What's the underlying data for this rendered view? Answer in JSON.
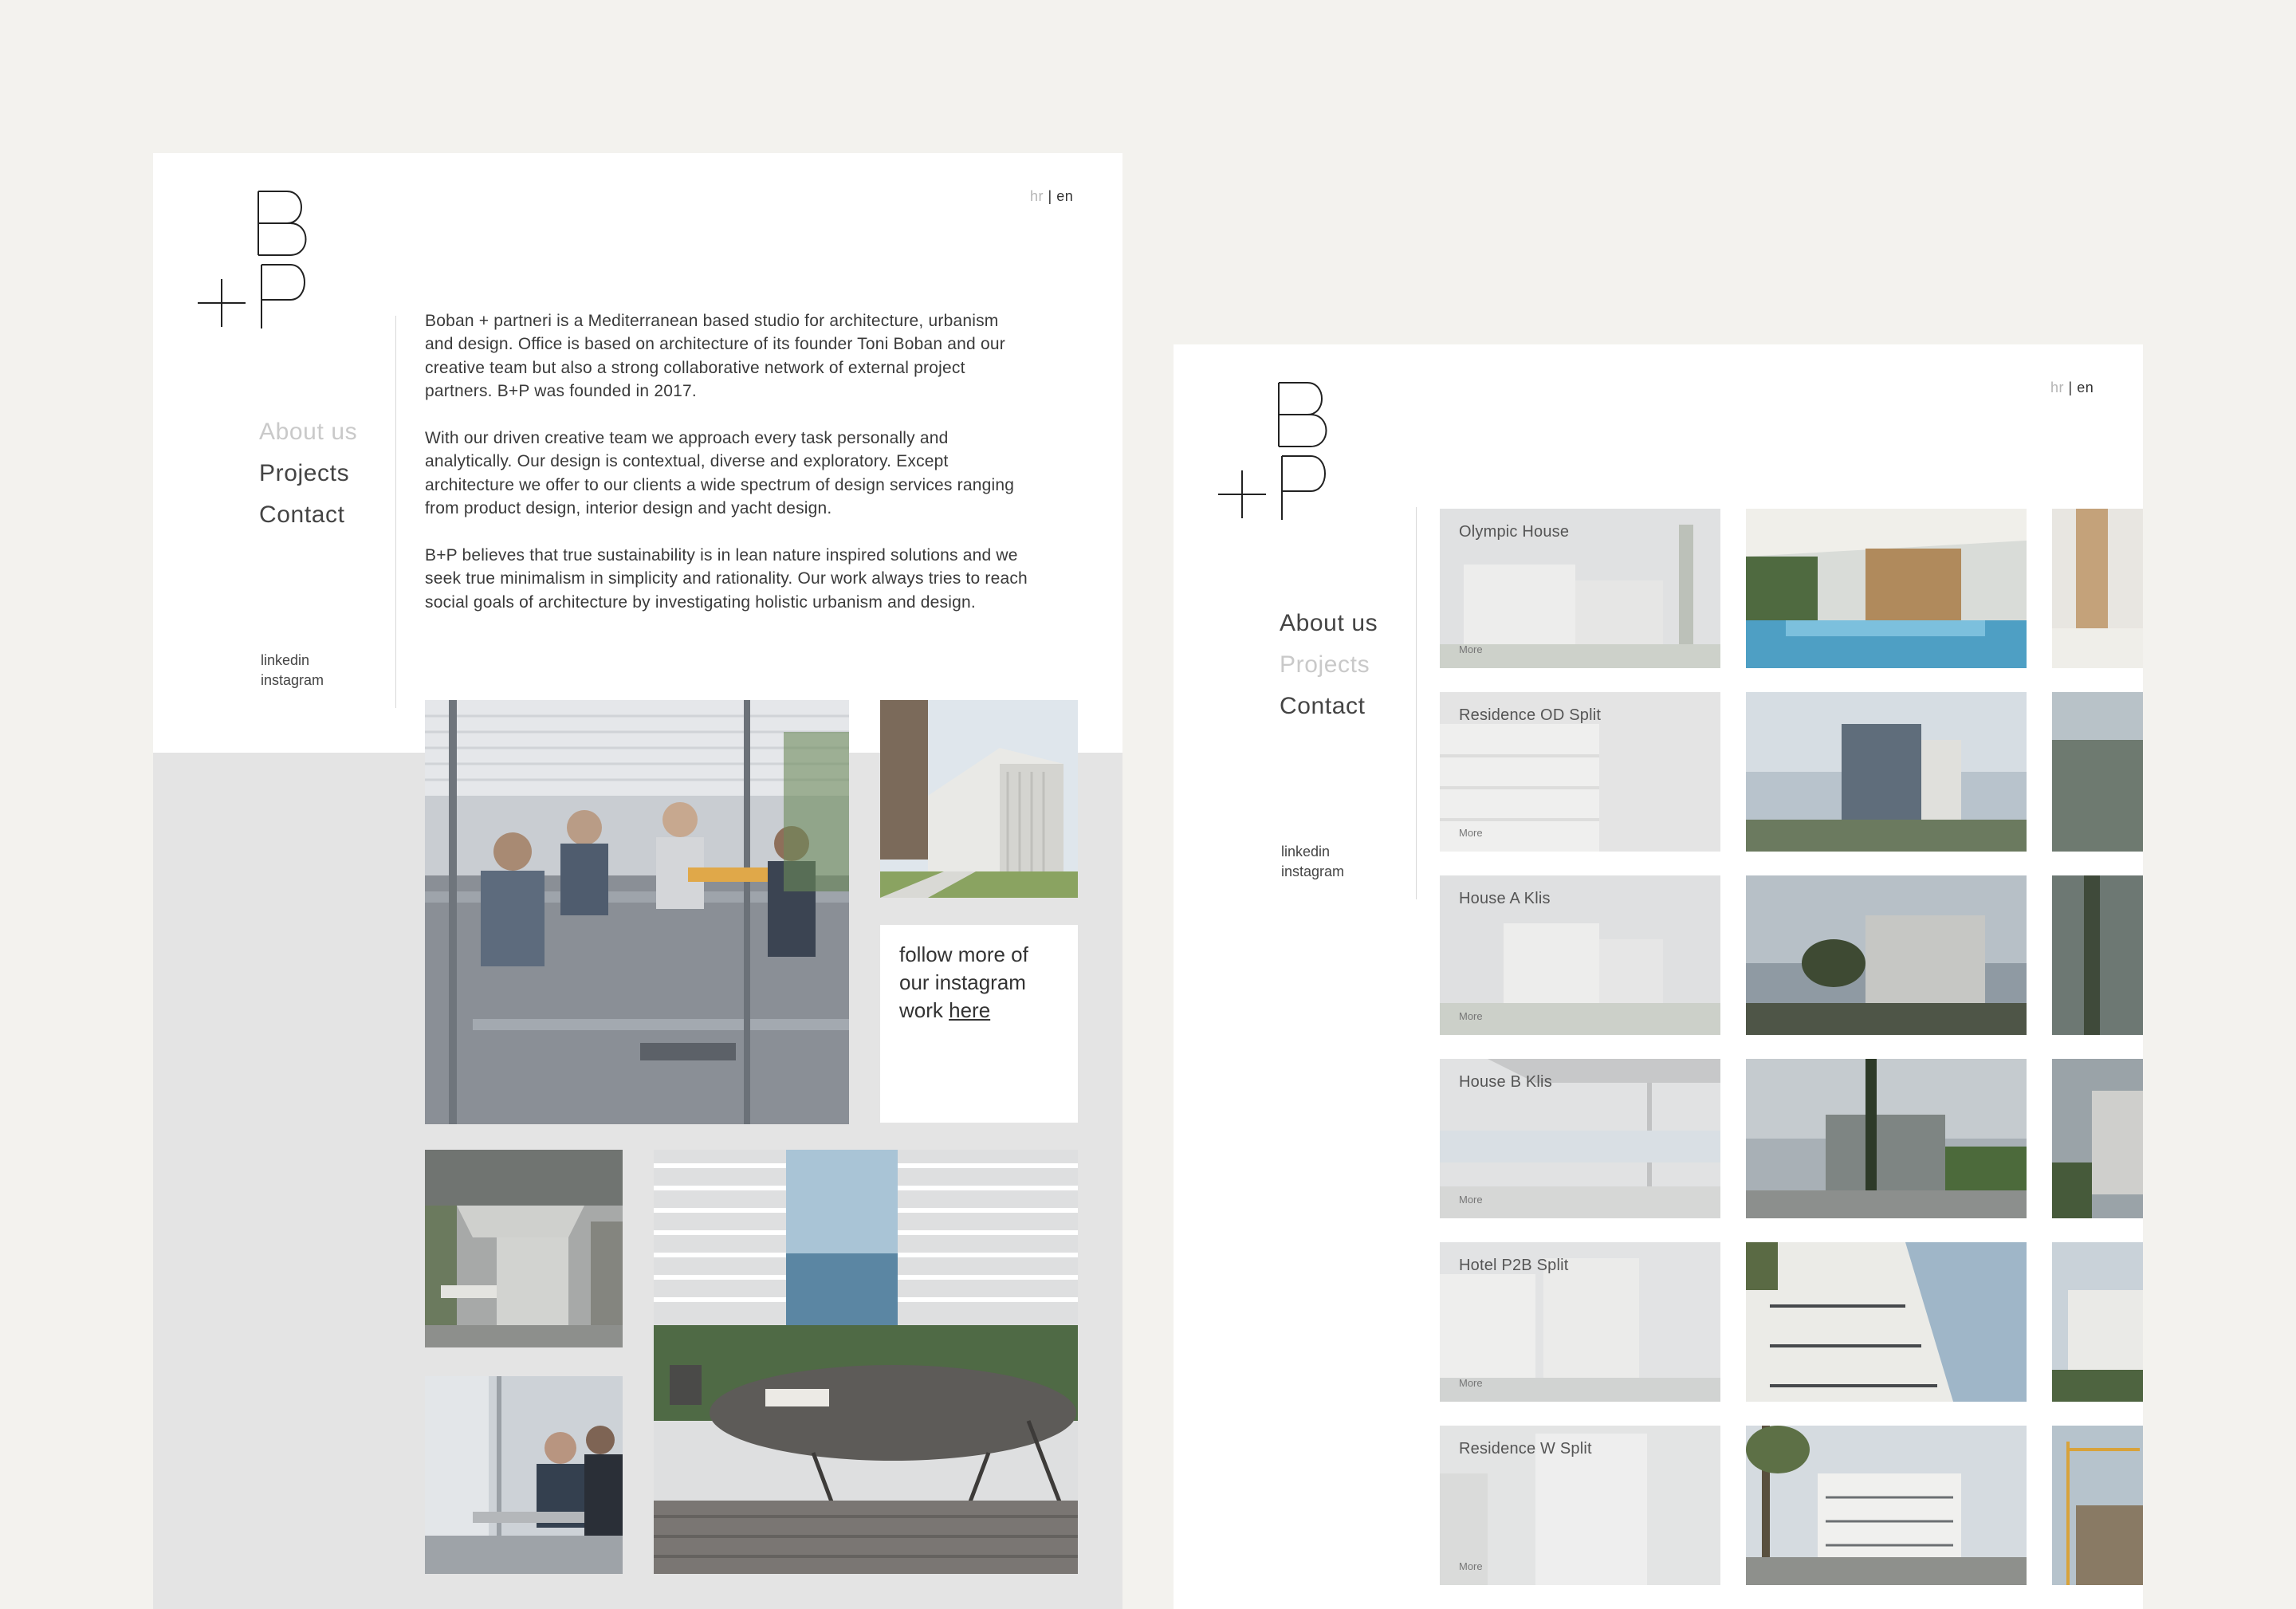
{
  "about_page": {
    "lang": {
      "hr": "hr",
      "sep": " | ",
      "en": "en"
    },
    "logo_text": "B+P",
    "nav": [
      {
        "label": "About us",
        "active": true
      },
      {
        "label": "Projects",
        "active": false
      },
      {
        "label": "Contact",
        "active": false
      }
    ],
    "social": [
      "linkedin",
      "instagram"
    ],
    "paragraphs": [
      "Boban + partneri is a Mediterranean based studio for architecture, urbanism and design. Office is based on architecture of its founder Toni Boban and our creative team but also a strong collaborative network of external project partners. B+P was founded in 2017.",
      "With our driven creative team we approach every task personally and analytically. Our design is contextual, diverse and exploratory. Except architecture we offer to our clients a wide spectrum of design services ranging from product design, interior design and yacht design.",
      "B+P believes that true sustainability is in lean nature inspired solutions and we seek true minimalism in simplicity and rationality. Our work always tries to reach social goals of architecture by investigating holistic urbanism and design."
    ],
    "instagram_box": {
      "text": "follow more of our instagram work ",
      "link": "here"
    },
    "photos": [
      {
        "name": "team-meeting-photo"
      },
      {
        "name": "white-villa-photo"
      },
      {
        "name": "interior-kitchen-photo"
      },
      {
        "name": "sea-view-table-photo"
      },
      {
        "name": "team-working-photo"
      }
    ]
  },
  "projects_page": {
    "lang": {
      "hr": "hr",
      "sep": " | ",
      "en": "en"
    },
    "logo_text": "B+P",
    "nav": [
      {
        "label": "About us",
        "active": false
      },
      {
        "label": "Projects",
        "active": true
      },
      {
        "label": "Contact",
        "active": false
      }
    ],
    "social": [
      "linkedin",
      "instagram"
    ],
    "more_label": "More",
    "projects": [
      {
        "title": "Olympic House"
      },
      {
        "title": "Residence OD Split"
      },
      {
        "title": "House A Klis"
      },
      {
        "title": "House B Klis"
      },
      {
        "title": "Hotel P2B Split"
      },
      {
        "title": "Residence W Split"
      }
    ],
    "colors": {
      "accent_muted": "#c9c9c9",
      "text": "#444444",
      "panel_grey": "#e4e4e4",
      "background": "#f3f2ee"
    }
  }
}
